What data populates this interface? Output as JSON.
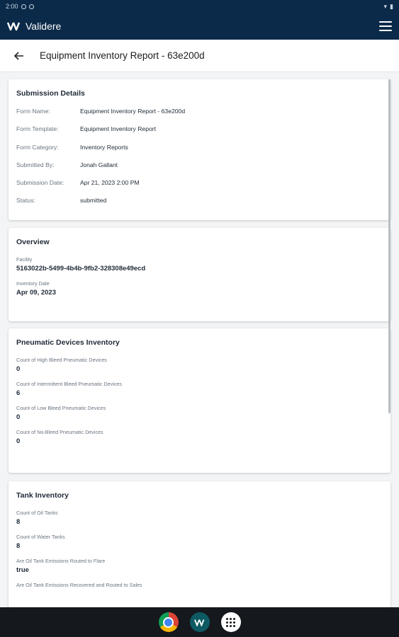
{
  "status_bar": {
    "time": "2:00"
  },
  "app_bar": {
    "brand_name": "Validere",
    "brand_color": "#0b2a4a"
  },
  "page": {
    "title": "Equipment Inventory Report - 63e200d"
  },
  "submission_details": {
    "title": "Submission Details",
    "rows": [
      {
        "label": "Form Name:",
        "value": "Equipment Inventory Report - 63e200d"
      },
      {
        "label": "Form Template:",
        "value": "Equipment Inventory Report"
      },
      {
        "label": "Form Category:",
        "value": "Inventory Reports"
      },
      {
        "label": "Submitted By:",
        "value": "Jonah Gallant"
      },
      {
        "label": "Submission Date:",
        "value": "Apr 21, 2023 2:00 PM"
      },
      {
        "label": "Status:",
        "value": "submitted"
      }
    ]
  },
  "overview": {
    "title": "Overview",
    "fields": [
      {
        "label": "Facility",
        "value": "5163022b-5499-4b4b-9fb2-328308e49ecd"
      },
      {
        "label": "Inventory Date",
        "value": "Apr 09, 2023"
      }
    ]
  },
  "pneumatic": {
    "title": "Pneumatic Devices Inventory",
    "fields": [
      {
        "label": "Count of High Bleed Pneumatic Devices",
        "value": "0"
      },
      {
        "label": "Count of Intermittent Bleed Pneumatic Devices",
        "value": "6"
      },
      {
        "label": "Count of Low Bleed Pneumatic Devices",
        "value": "0"
      },
      {
        "label": "Count of No-Bleed Pneumatic Devices",
        "value": "0"
      }
    ]
  },
  "tank": {
    "title": "Tank Inventory",
    "fields": [
      {
        "label": "Count of Oil Tanks",
        "value": "8"
      },
      {
        "label": "Count of Water Tanks",
        "value": "8"
      },
      {
        "label": "Are Oil Tank Emissions Routed to Flare",
        "value": "true"
      },
      {
        "label": "Are Oil Tank Emissions Recovered and Routed to Sales",
        "value": ""
      }
    ]
  },
  "dock": {
    "icons": [
      "chrome-icon",
      "validere-app-icon",
      "app-drawer-icon"
    ]
  }
}
